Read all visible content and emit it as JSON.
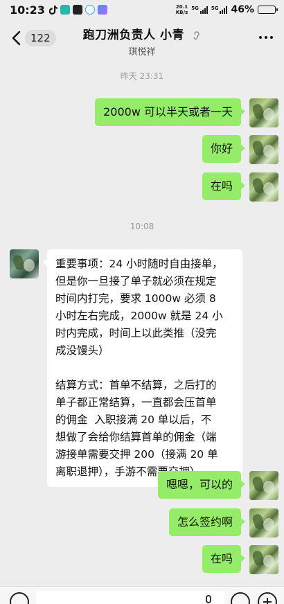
{
  "status_bar": {
    "time": "10:23",
    "net_speed": "20.1",
    "net_unit": "KB/s",
    "sim1_label": "5G",
    "sim2_label": "5G",
    "battery": "46%",
    "battery_level": 0.46
  },
  "header": {
    "back_count": "122",
    "title": "跑刀洲负责人 小青",
    "subtitle": "琪悦祥"
  },
  "timestamps": [
    "昨天 23:31",
    "10:08"
  ],
  "messages": [
    {
      "from": "me",
      "text": "2000w 可以半天或者一天"
    },
    {
      "from": "me",
      "text": "你好"
    },
    {
      "from": "me",
      "text": "在吗"
    },
    {
      "from": "them",
      "text": "重要事项：24 小时随时自由接单，\n但是你一旦接了单子就必须在规定\n时间内打完，要求 1000w 必须 8\n小时左右完成，2000w 就是 24 小\n时内完成，时间上以此类推（没完\n成没馒头）\n\n结算方式：首单不结算，之后打的\n单子都正常结算，一直都会压首单\n的佣金  入职接满 20 单以后，不\n想做了会给你结算首单的佣金（端\n游接单需要交押 200（接满 20 单\n离职退押），手游不需要交押）"
    },
    {
      "from": "me",
      "text": "嗯嗯，可以的"
    },
    {
      "from": "me",
      "text": "怎么签约啊"
    },
    {
      "from": "me",
      "text": "在吗"
    }
  ]
}
